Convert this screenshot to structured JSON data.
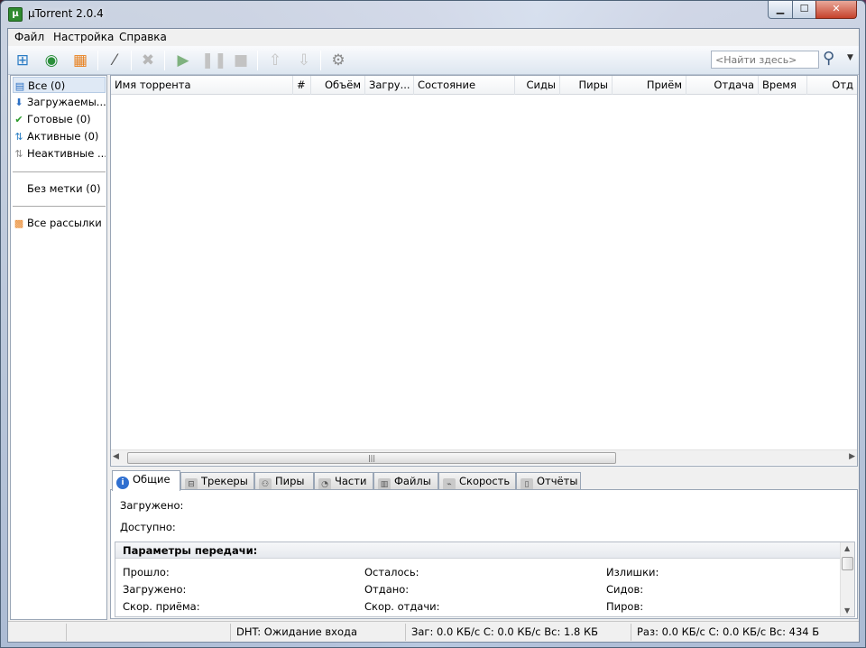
{
  "window": {
    "title": "µTorrent 2.0.4",
    "app_icon": "µ"
  },
  "menu": [
    {
      "label": "Файл"
    },
    {
      "label": "Настройка"
    },
    {
      "label": "Справка"
    }
  ],
  "search": {
    "placeholder": "<Найти здесь>"
  },
  "sidebar": {
    "items": [
      {
        "label": "Все (0)",
        "icon": "all-torrents-icon"
      },
      {
        "label": "Загружаемы...",
        "icon": "downloading-icon"
      },
      {
        "label": "Готовые (0)",
        "icon": "completed-icon"
      },
      {
        "label": "Активные (0)",
        "icon": "active-icon"
      },
      {
        "label": "Неактивные ...",
        "icon": "inactive-icon"
      }
    ],
    "label_item": {
      "label": "Без метки (0)"
    },
    "feeds_item": {
      "label": "Все рассылки",
      "icon": "rss-icon"
    }
  },
  "columns": [
    {
      "label": "Имя торрента"
    },
    {
      "label": "#"
    },
    {
      "label": "Объём"
    },
    {
      "label": "Загру..."
    },
    {
      "label": "Состояние"
    },
    {
      "label": "Сиды"
    },
    {
      "label": "Пиры"
    },
    {
      "label": "Приём"
    },
    {
      "label": "Отдача"
    },
    {
      "label": "Время"
    },
    {
      "label": "Отд"
    }
  ],
  "tabs": [
    {
      "label": "Общие"
    },
    {
      "label": "Трекеры"
    },
    {
      "label": "Пиры"
    },
    {
      "label": "Части"
    },
    {
      "label": "Файлы"
    },
    {
      "label": "Скорость"
    },
    {
      "label": "Отчёты"
    }
  ],
  "general": {
    "downloaded_label": "Загружено:",
    "available_label": "Доступно:"
  },
  "transfer": {
    "header": "Параметры передачи:",
    "elapsed": "Прошло:",
    "downloaded": "Загружено:",
    "down_speed": "Скор. приёма:",
    "remaining": "Осталось:",
    "uploaded": "Отдано:",
    "up_speed": "Скор. отдачи:",
    "wasted": "Излишки:",
    "seeds": "Сидов:",
    "peers": "Пиров:"
  },
  "status": {
    "dht": "DHT: Ожидание входа",
    "download": "Заг: 0.0 КБ/с С: 0.0 КБ/с Вс: 1.8 КБ",
    "upload": "Раз: 0.0 КБ/с С: 0.0 КБ/с Вс: 434 Б"
  },
  "colors": {
    "accent": "#2f6fd0",
    "selection": "#dfe9f5",
    "titlebar": "#b4c8e0"
  }
}
